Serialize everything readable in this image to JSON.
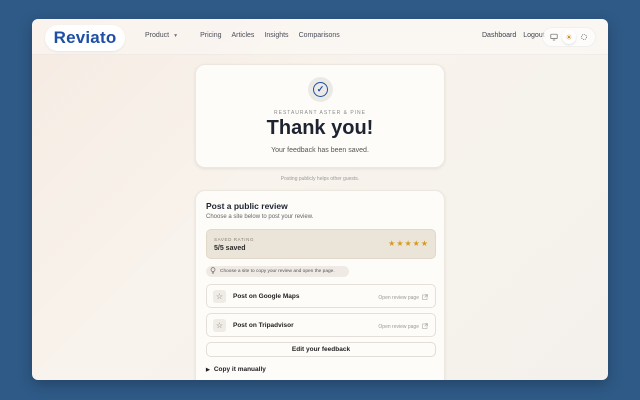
{
  "brand": {
    "name": "Reviato",
    "color": "#1f4fa5"
  },
  "nav": {
    "items": [
      {
        "label": "Product",
        "has_dropdown": true
      },
      {
        "label": "Pricing"
      },
      {
        "label": "Articles"
      },
      {
        "label": "Insights"
      },
      {
        "label": "Comparisons"
      }
    ],
    "right": {
      "dashboard": "Dashboard",
      "logout": "Logout"
    },
    "theme": {
      "options": [
        "monitor-icon",
        "sun-icon",
        "moon-icon"
      ],
      "active": "sun-icon"
    }
  },
  "thanks": {
    "restaurant": "RESTAURANT ASTER & PINE",
    "title": "Thank you!",
    "subtitle": "Your feedback has been saved."
  },
  "helper_note": "Posting publicly helps other guests.",
  "review": {
    "title": "Post a public review",
    "subtitle": "Choose a site below to post your review.",
    "rating": {
      "label": "SAVED RATING",
      "value": "5/5 saved",
      "stars": 5
    },
    "hint": "Choose a site to copy your review and open the page.",
    "sites": [
      {
        "label": "Post on Google Maps",
        "action": "Open review page"
      },
      {
        "label": "Post on Tripadvisor",
        "action": "Open review page"
      }
    ],
    "edit_button": "Edit your feedback",
    "copy_toggle": "Copy it manually"
  },
  "colors": {
    "accent": "#1f4fa5",
    "star": "#d89a1e",
    "background": "#2f5a87"
  }
}
